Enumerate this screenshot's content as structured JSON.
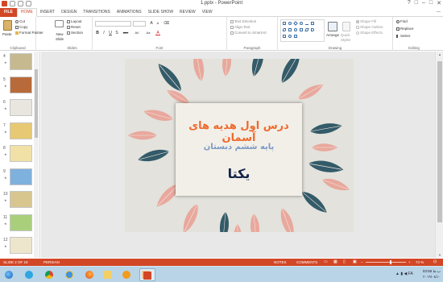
{
  "window": {
    "title": "1.pptx - PowerPoint",
    "controls": [
      "?",
      "□",
      "–",
      "□",
      "✕"
    ]
  },
  "ribbon_tabs": [
    "FILE",
    "HOME",
    "INSERT",
    "DESIGN",
    "TRANSITIONS",
    "ANIMATIONS",
    "SLIDE SHOW",
    "REVIEW",
    "VIEW"
  ],
  "user_label": "—",
  "ribbon": {
    "clipboard": {
      "paste": "Paste",
      "cut": "Cut",
      "copy": "Copy",
      "format_painter": "Format Painter",
      "label": "Clipboard"
    },
    "slides": {
      "new_slide": "New Slide",
      "layout": "Layout",
      "reset": "Reset",
      "section": "Section",
      "label": "Slides"
    },
    "font": {
      "label": "Font",
      "buttons": [
        "B",
        "I",
        "U",
        "S",
        "abc",
        "AV",
        "Aa",
        "A"
      ]
    },
    "paragraph": {
      "text_direction": "Text Direction",
      "align_text": "Align Text",
      "smartart": "Convert to SmartArt",
      "label": "Paragraph"
    },
    "drawing": {
      "arrange": "Arrange",
      "quick_styles": "Quick Styles",
      "shape_fill": "Shape Fill",
      "shape_outline": "Shape Outline",
      "shape_effects": "Shape Effects",
      "label": "Drawing"
    },
    "editing": {
      "find": "Find",
      "replace": "Replace",
      "select": "Select",
      "label": "Editing"
    }
  },
  "thumbnails": [
    {
      "num": "4",
      "selected": false,
      "color": "#c7b98f"
    },
    {
      "num": "5",
      "selected": false,
      "color": "#b96a3a"
    },
    {
      "num": "6",
      "selected": false,
      "color": "#e9e6e0"
    },
    {
      "num": "7",
      "selected": false,
      "color": "#e6c972"
    },
    {
      "num": "8",
      "selected": false,
      "color": "#f1e1a6"
    },
    {
      "num": "9",
      "selected": false,
      "color": "#7fb1dd"
    },
    {
      "num": "10",
      "selected": false,
      "color": "#d8c690"
    },
    {
      "num": "11",
      "selected": false,
      "color": "#a9cf7c"
    },
    {
      "num": "12",
      "selected": false,
      "color": "#eee6cc"
    }
  ],
  "slide": {
    "title": "درس اول هدیه های آسمان",
    "subtitle": "پایه ششم دبستان",
    "author": "یکتا"
  },
  "status": {
    "slide_of": "SLIDE 2 OF 19",
    "language": "PERSIAN",
    "notes": "NOTES",
    "comments": "COMMENTS",
    "zoom": "74 %"
  },
  "taskbar": {
    "time": "03:58 ب.ظ",
    "date": "۲۰۱۹/۰۸/۱۰",
    "lang": "FA",
    "apps": [
      "start",
      "telegram",
      "chrome",
      "firefox",
      "explorer",
      "media-player",
      "vlc",
      "powerpoint"
    ]
  },
  "colors": {
    "accent": "#d24726",
    "title": "#ee6a2e",
    "subtitle": "#7b9ac6",
    "author": "#14234a",
    "teal_leaf": "#1f4d5c",
    "pink_leaf": "#e9a296"
  }
}
